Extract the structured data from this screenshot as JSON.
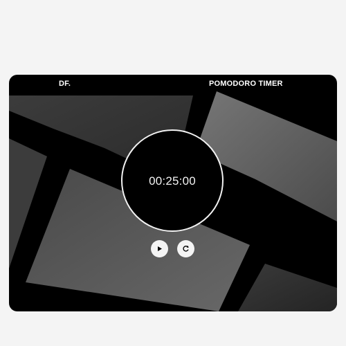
{
  "header": {
    "brand": "DF.",
    "title": "POMODORO TIMER"
  },
  "timer": {
    "display": "00:25:00"
  },
  "controls": [
    {
      "name": "play-button",
      "icon": "play-icon"
    },
    {
      "name": "reset-button",
      "icon": "restart-icon"
    }
  ],
  "colors": {
    "window": "#000000",
    "page_background": "#f4f4f4",
    "ring": "#f2f2f2",
    "button": "#f4f4f4",
    "panel_light": "#666666",
    "panel_dark": "#333333"
  }
}
